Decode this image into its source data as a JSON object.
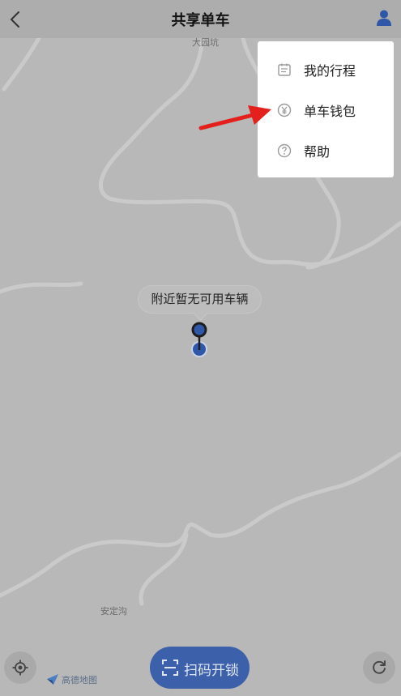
{
  "header": {
    "title": "共享单车",
    "back_icon": "chevron-left-icon",
    "user_icon": "user-icon"
  },
  "menu": {
    "items": [
      {
        "label": "我的行程",
        "icon": "calendar-icon"
      },
      {
        "label": "单车钱包",
        "icon": "yen-icon"
      },
      {
        "label": "帮助",
        "icon": "help-icon"
      }
    ]
  },
  "map": {
    "places": [
      "大园坑",
      "安定沟"
    ],
    "notice": "附近暂无可用车辆",
    "provider": "高德地图"
  },
  "actions": {
    "scan_label": "扫码开锁",
    "locate_icon": "locate-icon",
    "refresh_icon": "refresh-icon"
  },
  "colors": {
    "accent": "#3d60ab",
    "arrow": "#e3201b",
    "overlay": "#b7b7b7"
  }
}
